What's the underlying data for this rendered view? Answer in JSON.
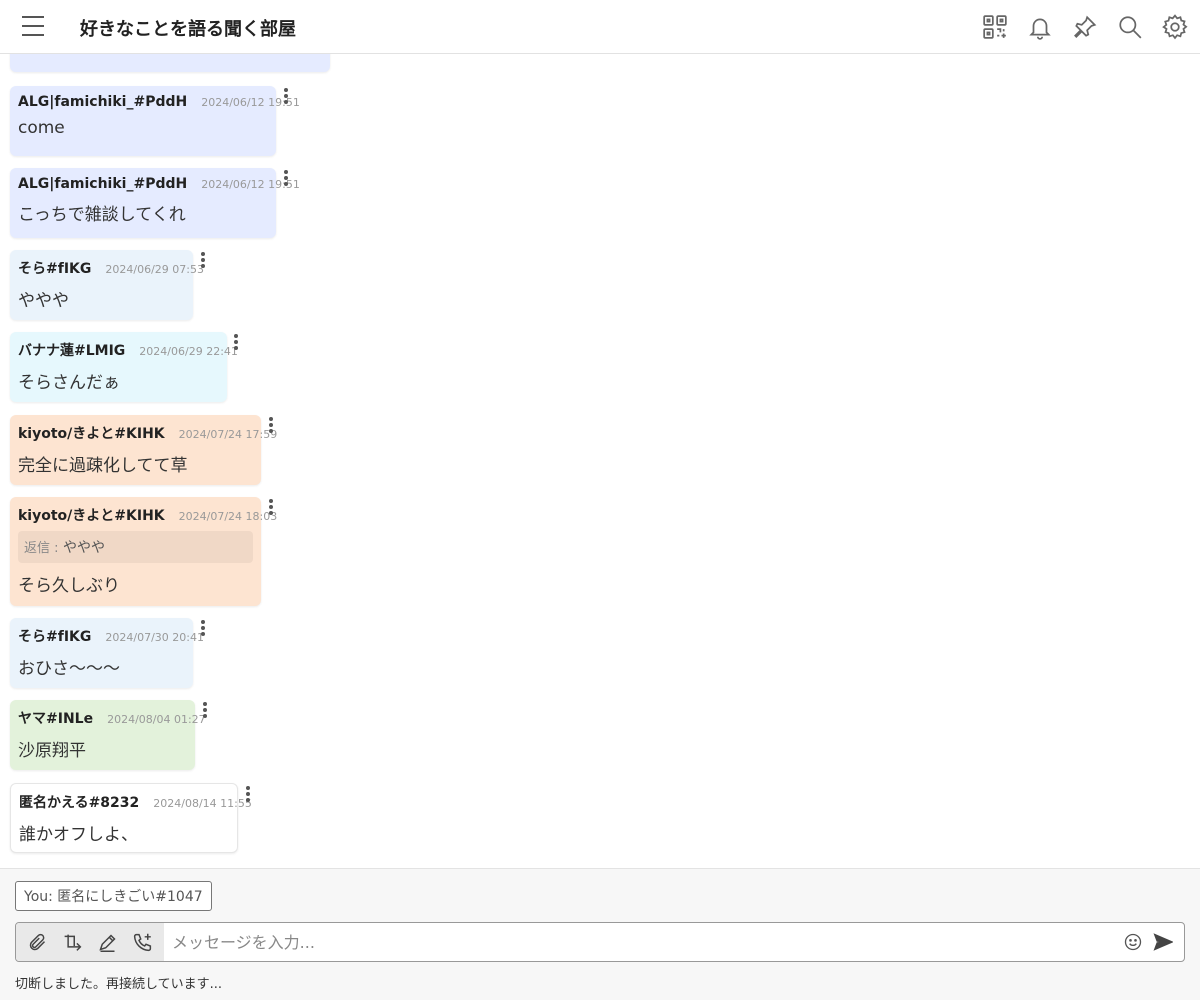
{
  "header": {
    "title": "好きなことを語る聞く部屋"
  },
  "messages": [
    {
      "author": "ALG|famichiki_#PddH",
      "time": "2024/06/12 19:51",
      "text": "come"
    },
    {
      "author": "ALG|famichiki_#PddH",
      "time": "2024/06/12 19:51",
      "text": "こっちで雑談してくれ"
    },
    {
      "author": "そら#fIKG",
      "time": "2024/06/29 07:53",
      "text": "ややや"
    },
    {
      "author": "バナナ蓮#LMIG",
      "time": "2024/06/29 22:41",
      "text": "そらさんだぁ"
    },
    {
      "author": "kiyoto/きよと#KIHK",
      "time": "2024/07/24 17:59",
      "text": "完全に過疎化してて草"
    },
    {
      "author": "kiyoto/きよと#KIHK",
      "time": "2024/07/24 18:03",
      "reply_label": "返信 :",
      "reply_text": "ややや",
      "text": "そら久しぶり"
    },
    {
      "author": "そら#fIKG",
      "time": "2024/07/30 20:41",
      "text": "おひさ〜〜〜"
    },
    {
      "author": "ヤマ#INLe",
      "time": "2024/08/04 01:27",
      "text": "沙原翔平"
    },
    {
      "author": "匿名かえる#8232",
      "time": "2024/08/14 11:55",
      "text": "誰かオフしよ、"
    }
  ],
  "composer": {
    "you": "You: 匿名にしきごい#1047",
    "placeholder": "メッセージを入力...",
    "status": "切断しました。再接続しています..."
  }
}
